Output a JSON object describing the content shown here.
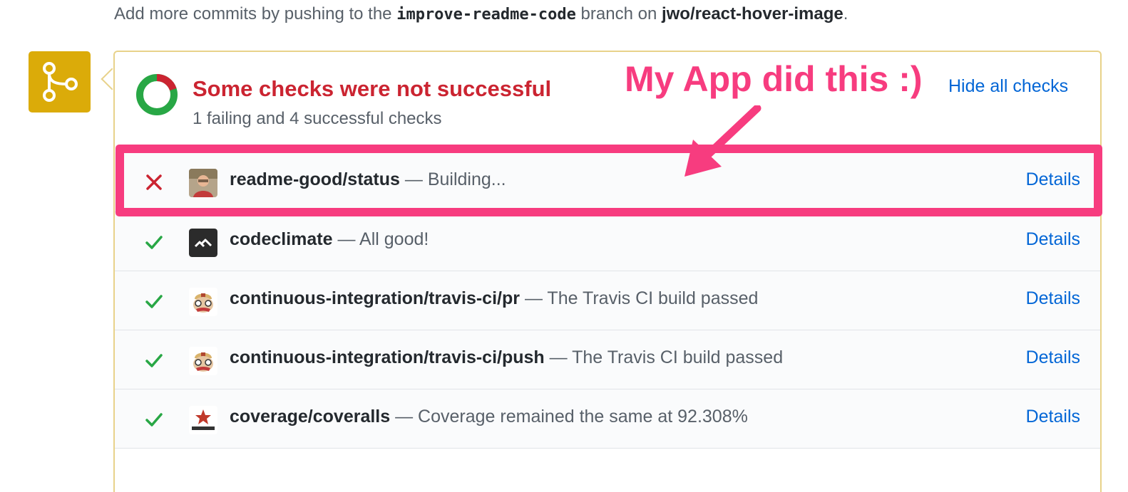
{
  "header": {
    "prefix": "Add more commits by pushing to the",
    "branch": "improve-readme-code",
    "middle": "branch on",
    "repo": "jwo/react-hover-image",
    "suffix": "."
  },
  "summary": {
    "title": "Some checks were not successful",
    "subtitle": "1 failing and 4 successful checks",
    "hide_label": "Hide all checks",
    "failing_count": 1,
    "successful_count": 4
  },
  "checks": [
    {
      "state": "failure",
      "context": "readme-good/status",
      "description": "— Building...",
      "details_label": "Details",
      "avatar": "user-avatar"
    },
    {
      "state": "success",
      "context": "codeclimate",
      "description": "— All good!",
      "details_label": "Details",
      "avatar": "codeclimate-icon"
    },
    {
      "state": "success",
      "context": "continuous-integration/travis-ci/pr",
      "description": "— The Travis CI build passed",
      "details_label": "Details",
      "avatar": "travis-icon"
    },
    {
      "state": "success",
      "context": "continuous-integration/travis-ci/push",
      "description": "— The Travis CI build passed",
      "details_label": "Details",
      "avatar": "travis-icon"
    },
    {
      "state": "success",
      "context": "coverage/coveralls",
      "description": "— Coverage remained the same at 92.308%",
      "details_label": "Details",
      "avatar": "coveralls-icon"
    }
  ],
  "annotation": {
    "text": "My App did this :)"
  },
  "colors": {
    "failure": "#cb2431",
    "success": "#28a745",
    "link": "#0366d6",
    "badge": "#dbab09",
    "annotation": "#f73c7f"
  }
}
